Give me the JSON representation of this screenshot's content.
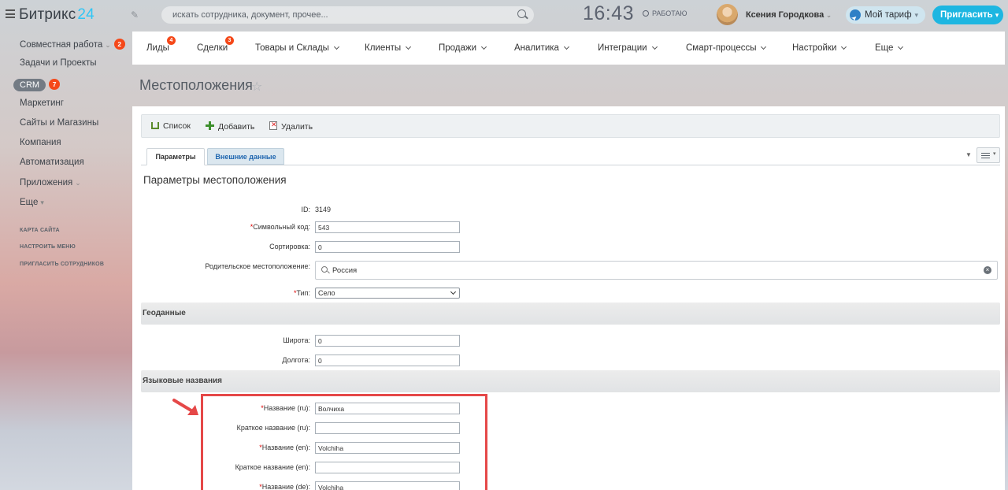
{
  "topbar": {
    "logo_main": "Битрикс",
    "logo_num": "24",
    "search_placeholder": "искать сотрудника, документ, прочее...",
    "clock": "16:43",
    "work_status": "РАБОТАЮ",
    "user_name": "Ксения Городкова",
    "tariff_label": "Мой тариф",
    "invite_label": "Пригласить"
  },
  "leftmenu": {
    "items": [
      {
        "label": "Совместная работа",
        "badge": "2"
      },
      {
        "label": "Задачи и Проекты"
      },
      {
        "label": "CRM",
        "badge": "7"
      },
      {
        "label": "Маркетинг"
      },
      {
        "label": "Сайты и Магазины"
      },
      {
        "label": "Компания"
      },
      {
        "label": "Автоматизация"
      },
      {
        "label": "Приложения"
      },
      {
        "label": "Еще"
      }
    ],
    "small_links": [
      "КАРТА САЙТА",
      "НАСТРОИТЬ МЕНЮ",
      "ПРИГЛАСИТЬ СОТРУДНИКОВ"
    ]
  },
  "hmenu": {
    "items": [
      {
        "label": "Лиды",
        "badge": "4"
      },
      {
        "label": "Сделки",
        "badge": "3"
      },
      {
        "label": "Товары и Склады"
      },
      {
        "label": "Клиенты"
      },
      {
        "label": "Продажи"
      },
      {
        "label": "Аналитика"
      },
      {
        "label": "Интеграции"
      },
      {
        "label": "Смарт-процессы"
      },
      {
        "label": "Настройки"
      },
      {
        "label": "Еще"
      }
    ]
  },
  "page": {
    "title": "Местоположения"
  },
  "toolbar": {
    "list": "Список",
    "add": "Добавить",
    "delete": "Удалить"
  },
  "tabs": {
    "params": "Параметры",
    "external": "Внешние данные"
  },
  "form": {
    "section_title": "Параметры местоположения",
    "id_label": "ID:",
    "id_value": "3149",
    "code_label": "Символьный код:",
    "code_value": "543",
    "sort_label": "Сортировка:",
    "sort_value": "0",
    "parent_label": "Родительское местоположение:",
    "parent_value": "Россия",
    "type_label": "Тип:",
    "type_value": "Село",
    "geo_header": "Геоданные",
    "lat_label": "Широта:",
    "lat_value": "0",
    "lon_label": "Долгота:",
    "lon_value": "0",
    "lang_header": "Языковые названия",
    "name_ru_label": "Название (ru):",
    "name_ru_value": "Волчиха",
    "short_ru_label": "Краткое название (ru):",
    "short_ru_value": "",
    "name_en_label": "Название (en):",
    "name_en_value": "Volchiha",
    "short_en_label": "Краткое название (en):",
    "short_en_value": "",
    "name_de_label": "Название (de):",
    "name_de_value": "Volchiha"
  },
  "colors": {
    "accent": "#2fc6f6",
    "invite_bg": "#1db6e1",
    "badge": "#f54819",
    "highlight": "#e54848"
  }
}
